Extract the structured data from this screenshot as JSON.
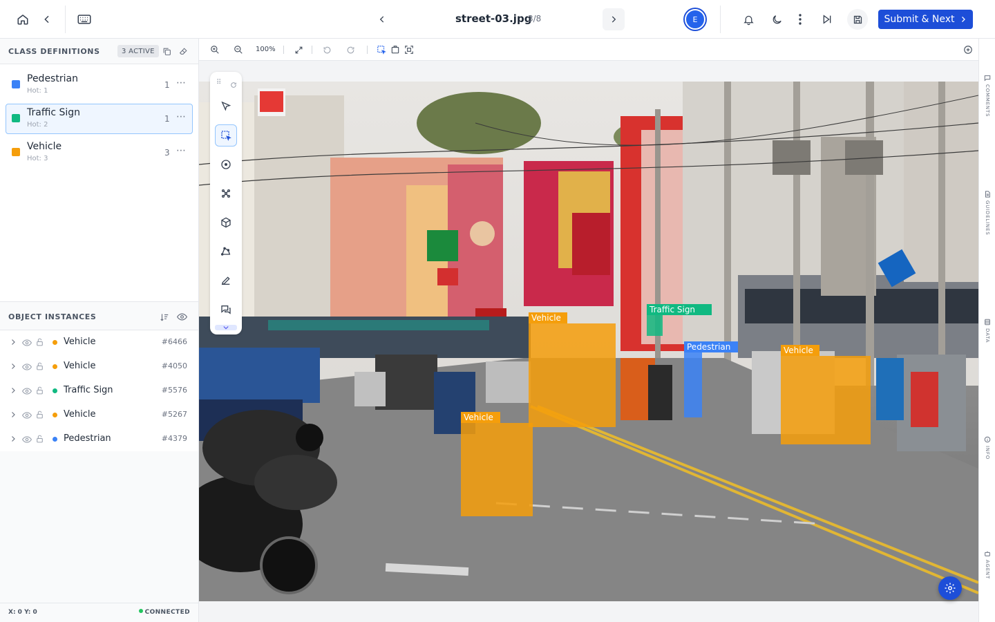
{
  "header": {
    "file_name": "street-03.jpg",
    "file_position": "3/8",
    "avatar_initial": "E",
    "submit_label": "Submit & Next"
  },
  "class_panel": {
    "title": "CLASS DEFINITIONS",
    "active_badge": "3 ACTIVE",
    "classes": [
      {
        "name": "Pedestrian",
        "hotkey": "Hot: 1",
        "count": "1",
        "color": "#3b82f6"
      },
      {
        "name": "Traffic Sign",
        "hotkey": "Hot: 2",
        "count": "1",
        "color": "#10b981"
      },
      {
        "name": "Vehicle",
        "hotkey": "Hot: 3",
        "count": "3",
        "color": "#f59e0b"
      }
    ]
  },
  "instances_panel": {
    "title": "OBJECT INSTANCES",
    "items": [
      {
        "name": "Vehicle",
        "id": "#6466",
        "color": "#f59e0b"
      },
      {
        "name": "Vehicle",
        "id": "#4050",
        "color": "#f59e0b"
      },
      {
        "name": "Traffic Sign",
        "id": "#5576",
        "color": "#10b981"
      },
      {
        "name": "Vehicle",
        "id": "#5267",
        "color": "#f59e0b"
      },
      {
        "name": "Pedestrian",
        "id": "#4379",
        "color": "#3b82f6"
      }
    ]
  },
  "status": {
    "coords": "X: 0 Y: 0",
    "connection": "CONNECTED"
  },
  "canvas_toolbar": {
    "zoom": "100%"
  },
  "annotations": {
    "labels": [
      "Vehicle",
      "Traffic Sign",
      "Pedestrian",
      "Vehicle",
      "Vehicle"
    ]
  },
  "right_rail": {
    "tabs": [
      "COMMENTS",
      "GUIDELINES",
      "DATA",
      "INFO",
      "AGENT"
    ]
  },
  "colors": {
    "accent": "#1d4ed8",
    "pedestrian": "#3b82f6",
    "traffic_sign": "#10b981",
    "vehicle": "#f59e0b"
  }
}
